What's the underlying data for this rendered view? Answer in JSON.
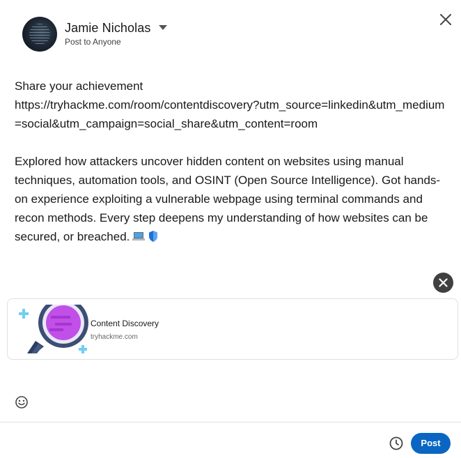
{
  "header": {
    "author_name": "Jamie Nicholas",
    "visibility": "Post to Anyone"
  },
  "post": {
    "line1": "Share your achievement",
    "link": "https://tryhackme.com/room/contentdiscovery?utm_source=linkedin&utm_medium=social&utm_campaign=social_share&utm_content=room",
    "description": "Explored how attackers uncover hidden content on websites using manual techniques, automation tools, and OSINT (Open Source Intelligence). Got hands-on experience exploiting a vulnerable webpage using terminal commands and recon methods. Every step deepens my understanding of how websites can be secured, or breached."
  },
  "link_preview": {
    "title": "Content Discovery",
    "domain": "tryhackme.com"
  },
  "footer": {
    "post_label": "Post"
  },
  "icons": {
    "close": "close-icon",
    "remove_preview": "close-icon",
    "emoji": "smiley-icon",
    "schedule": "clock-icon",
    "dropdown": "caret-down-icon"
  },
  "colors": {
    "primary_button": "#0a66c2",
    "remove_button": "#404040"
  }
}
